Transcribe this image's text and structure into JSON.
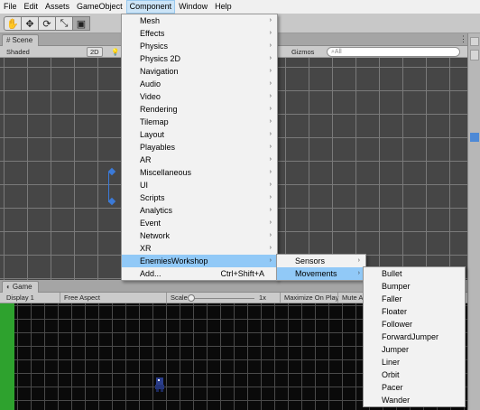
{
  "menubar": {
    "items": [
      "File",
      "Edit",
      "Assets",
      "GameObject",
      "Component",
      "Window",
      "Help"
    ],
    "active_index": 4
  },
  "toolbar": {
    "tools": [
      {
        "icon": "hand-icon",
        "glyph": "✋"
      },
      {
        "icon": "move-icon",
        "glyph": "✥"
      },
      {
        "icon": "rotate-icon",
        "glyph": "⟳"
      },
      {
        "icon": "scale-icon",
        "glyph": "⤡"
      },
      {
        "icon": "rect-icon",
        "glyph": "▣"
      }
    ],
    "selected_tool": 4
  },
  "scene": {
    "tab_label": "Scene",
    "shading_mode": "Shaded",
    "mode_2d": "2D",
    "gizmos_label": "Gizmos",
    "search_placeholder": "All"
  },
  "game": {
    "tab_label": "Game",
    "display": "Display 1",
    "aspect": "Free Aspect",
    "scale_label": "Scale",
    "scale_value": "1x",
    "maximize_label": "Maximize On Play",
    "mute_label": "Mute A"
  },
  "component_menu": {
    "items": [
      {
        "label": "Mesh",
        "submenu": true
      },
      {
        "label": "Effects",
        "submenu": true
      },
      {
        "label": "Physics",
        "submenu": true
      },
      {
        "label": "Physics 2D",
        "submenu": true
      },
      {
        "label": "Navigation",
        "submenu": true
      },
      {
        "label": "Audio",
        "submenu": true
      },
      {
        "label": "Video",
        "submenu": true
      },
      {
        "label": "Rendering",
        "submenu": true
      },
      {
        "label": "Tilemap",
        "submenu": true
      },
      {
        "label": "Layout",
        "submenu": true
      },
      {
        "label": "Playables",
        "submenu": true
      },
      {
        "label": "AR",
        "submenu": true
      },
      {
        "label": "Miscellaneous",
        "submenu": true
      },
      {
        "label": "UI",
        "submenu": true
      },
      {
        "label": "Scripts",
        "submenu": true
      },
      {
        "label": "Analytics",
        "submenu": true
      },
      {
        "label": "Event",
        "submenu": true
      },
      {
        "label": "Network",
        "submenu": true
      },
      {
        "label": "XR",
        "submenu": true
      },
      {
        "label": "EnemiesWorkshop",
        "submenu": true,
        "highlighted": true
      },
      {
        "label": "Add...",
        "shortcut": "Ctrl+Shift+A"
      }
    ]
  },
  "enemies_menu": {
    "items": [
      {
        "label": "Sensors",
        "submenu": true
      },
      {
        "label": "Movements",
        "submenu": true,
        "highlighted": true
      }
    ]
  },
  "movements_menu": {
    "items": [
      "Bullet",
      "Bumper",
      "Faller",
      "Floater",
      "Follower",
      "ForwardJumper",
      "Jumper",
      "Liner",
      "Orbit",
      "Pacer",
      "Wander"
    ]
  },
  "colors": {
    "menu_highlight": "#91c9f7",
    "active_menubar": "#cce4f7",
    "game_green": "#2ea22e",
    "gizmo_blue": "#3b7ad8"
  }
}
